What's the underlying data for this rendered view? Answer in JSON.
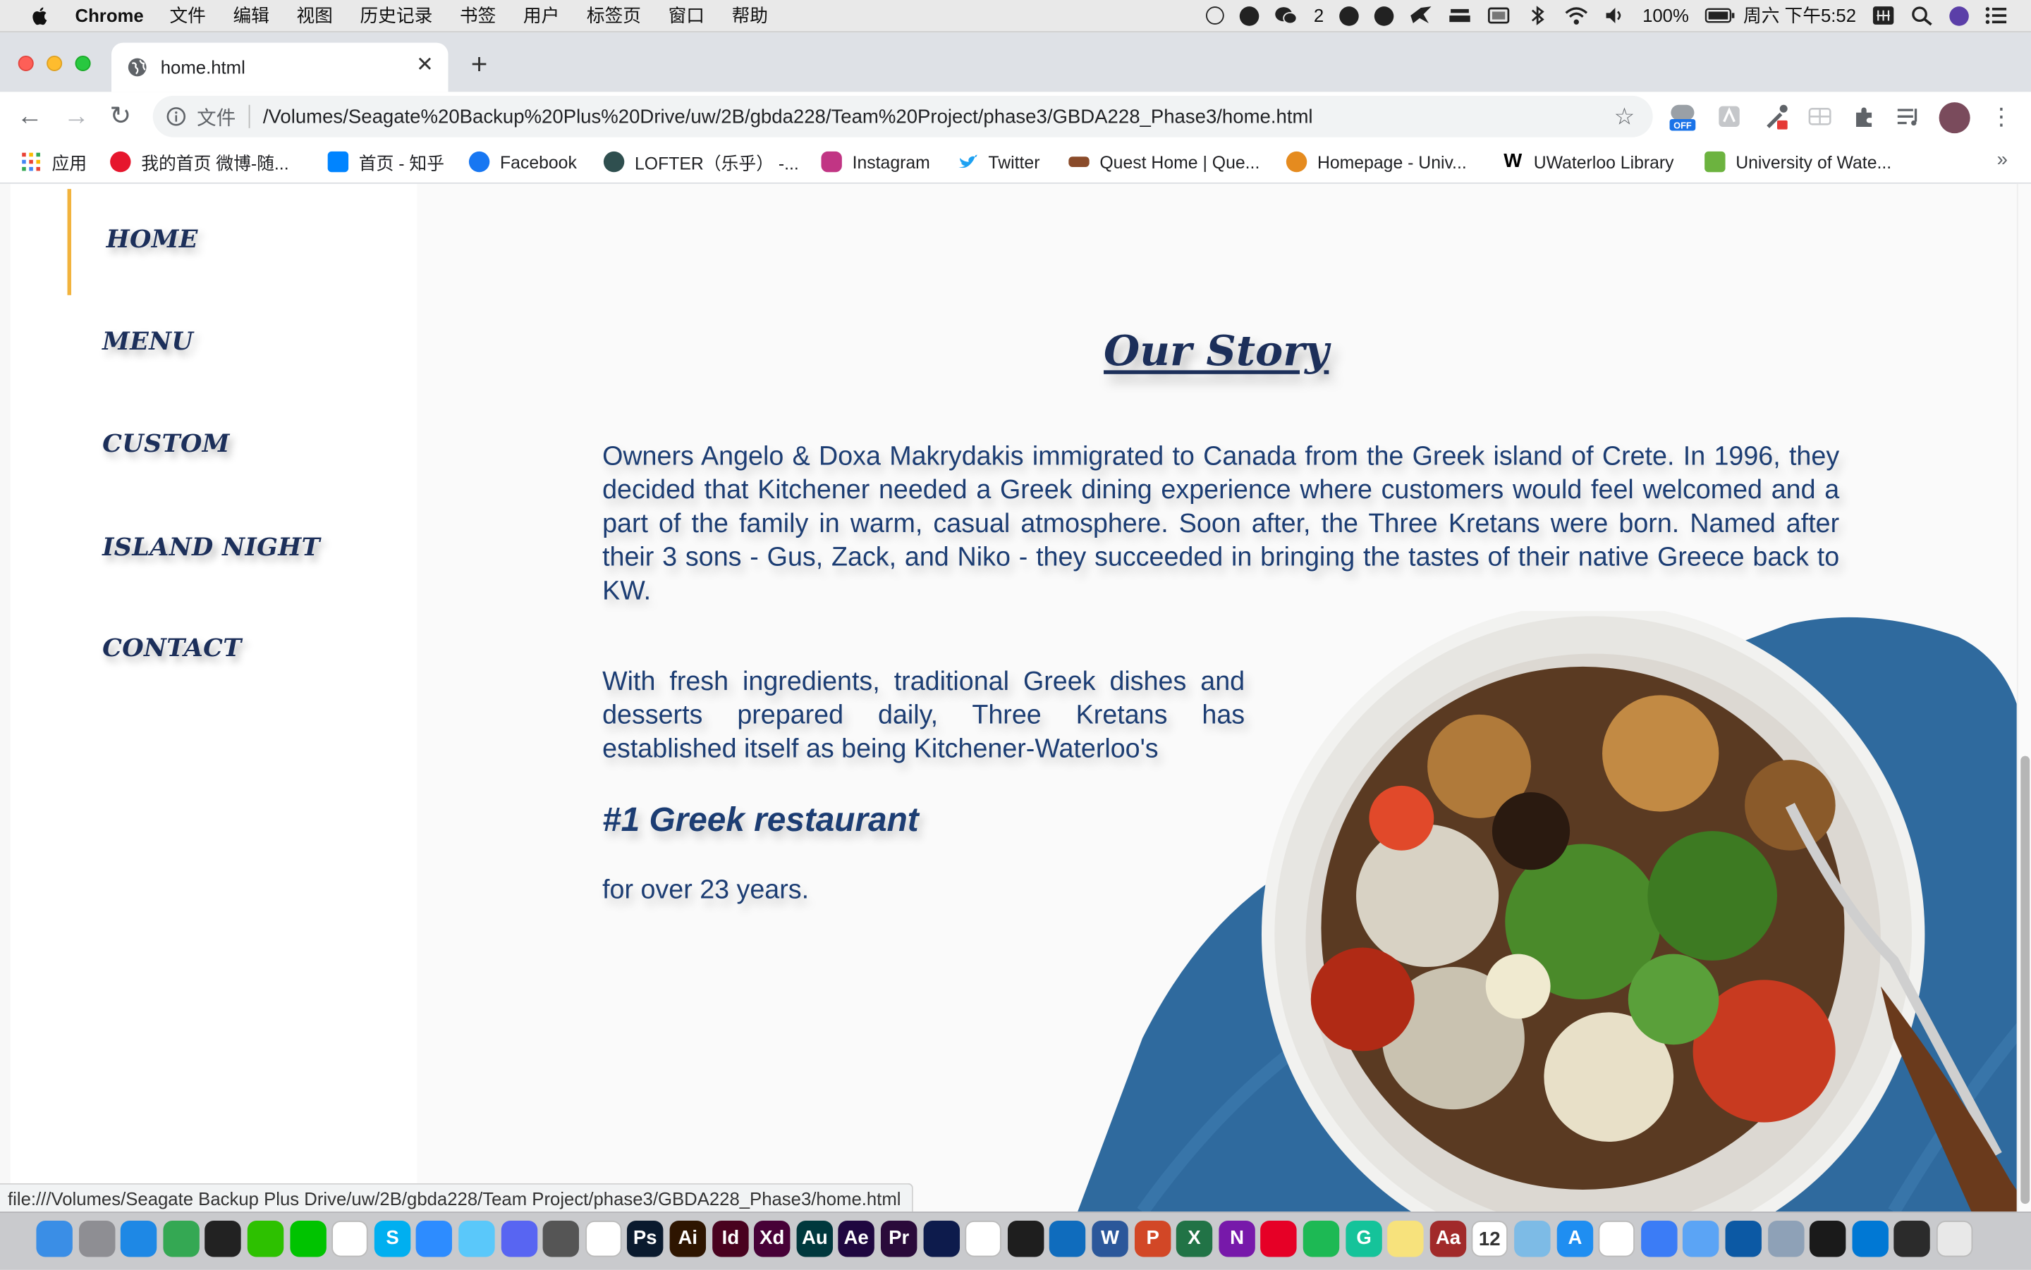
{
  "menubar": {
    "app_name": "Chrome",
    "menus": [
      "文件",
      "编辑",
      "视图",
      "历史记录",
      "书签",
      "用户",
      "标签页",
      "窗口",
      "帮助"
    ],
    "wechat_badge": "2",
    "battery": "100%",
    "datetime": "周六 下午5:52"
  },
  "tab": {
    "title": "home.html"
  },
  "toolbar": {
    "file_label": "文件",
    "url": "/Volumes/Seagate%20Backup%20Plus%20Drive/uw/2B/gbda228/Team%20Project/phase3/GBDA228_Phase3/home.html",
    "ext_badge": "OFF"
  },
  "bookmarks": [
    {
      "label": "应用",
      "icon": "apps-grid-icon",
      "color": "#e94235"
    },
    {
      "label": "我的首页 微博-随...",
      "icon": "weibo-icon",
      "color": "#e6162d"
    },
    {
      "label": "首页 - 知乎",
      "icon": "zhihu-icon",
      "color": "#0084ff"
    },
    {
      "label": "Facebook",
      "icon": "facebook-icon",
      "color": "#1877f2"
    },
    {
      "label": "LOFTER（乐乎） -...",
      "icon": "lofter-icon",
      "color": "#2f4f4f"
    },
    {
      "label": "Instagram",
      "icon": "instagram-icon",
      "color": "#c13584"
    },
    {
      "label": "Twitter",
      "icon": "twitter-icon",
      "color": "#1da1f2"
    },
    {
      "label": "Quest Home | Que...",
      "icon": "quest-icon",
      "color": "#8a4b2a"
    },
    {
      "label": "Homepage - Univ...",
      "icon": "uw-homepage-icon",
      "color": "#e58b1f"
    },
    {
      "label": "UWaterloo Library",
      "icon": "uwaterloo-library-icon",
      "color": "#000000"
    },
    {
      "label": "University of Wate...",
      "icon": "uw-flag-icon",
      "color": "#6cb33f"
    }
  ],
  "page": {
    "nav": [
      "HOME",
      "MENU",
      "CUSTOM",
      "ISLAND NIGHT",
      "CONTACT"
    ],
    "active_nav": "HOME",
    "title": "Our Story",
    "paragraph1": "Owners Angelo & Doxa Makrydakis immigrated to Canada from the Greek island of Crete. In 1996, they decided that Kitchener needed a Greek dining experience where customers would feel welcomed and a part of the family in warm, casual atmosphere. Soon after, the Three Kretans were born. Named after their 3 sons - Gus, Zack, and Niko - they succeeded in bringing the tastes of their native Greece back to KW.",
    "paragraph2": "With fresh ingredients, traditional Greek dishes and desserts prepared daily, Three Kretans has established itself as being Kitchener-Waterloo's",
    "highlight": "#1 Greek restaurant",
    "paragraph3": "for over 23 years.",
    "status_url": "file:///Volumes/Seagate Backup Plus Drive/uw/2B/gbda228/Team Project/phase3/GBDA228_Phase3/home.html"
  },
  "colors": {
    "nav_text": "#1c2f5a",
    "accent_bar": "#f2b33d",
    "body_text": "#1c3d73",
    "napkin": "#2f6a9e"
  },
  "dock": [
    {
      "name": "finder-icon",
      "color": "#3a8ee6",
      "label": ""
    },
    {
      "name": "launchpad-icon",
      "color": "#8e8e93",
      "label": ""
    },
    {
      "name": "safari-icon",
      "color": "#1e88e5",
      "label": ""
    },
    {
      "name": "chrome-icon",
      "color": "#34a853",
      "label": ""
    },
    {
      "name": "qq-icon",
      "color": "#222222",
      "label": ""
    },
    {
      "name": "wechat-icon",
      "color": "#2dc100",
      "label": ""
    },
    {
      "name": "line-icon",
      "color": "#00c300",
      "label": ""
    },
    {
      "name": "slack-icon",
      "color": "#ffffff",
      "label": ""
    },
    {
      "name": "skype-icon",
      "color": "#00aff0",
      "label": "S"
    },
    {
      "name": "zoom-icon",
      "color": "#2d8cff",
      "label": ""
    },
    {
      "name": "messages-icon",
      "color": "#5ac8fa",
      "label": ""
    },
    {
      "name": "discord-icon",
      "color": "#5865f2",
      "label": ""
    },
    {
      "name": "facetime-icon",
      "color": "#555555",
      "label": ""
    },
    {
      "name": "circle-app-icon",
      "color": "#ffffff",
      "label": ""
    },
    {
      "name": "photoshop-icon",
      "color": "#0a1a2e",
      "label": "Ps"
    },
    {
      "name": "illustrator-icon",
      "color": "#2e1500",
      "label": "Ai"
    },
    {
      "name": "indesign-icon",
      "color": "#49021f",
      "label": "Id"
    },
    {
      "name": "xd-icon",
      "color": "#470137",
      "label": "Xd"
    },
    {
      "name": "audition-icon",
      "color": "#00383d",
      "label": "Au"
    },
    {
      "name": "after-effects-icon",
      "color": "#1f0740",
      "label": "Ae"
    },
    {
      "name": "premiere-icon",
      "color": "#2a0a3a",
      "label": "Pr"
    },
    {
      "name": "media-encoder-icon",
      "color": "#0d1b4c",
      "label": ""
    },
    {
      "name": "emoji-app-icon",
      "color": "#ffffff",
      "label": ""
    },
    {
      "name": "figma-icon",
      "color": "#1e1e1e",
      "label": ""
    },
    {
      "name": "outlook-icon",
      "color": "#0f6cbd",
      "label": ""
    },
    {
      "name": "word-icon",
      "color": "#2b579a",
      "label": "W"
    },
    {
      "name": "powerpoint-icon",
      "color": "#d24726",
      "label": "P"
    },
    {
      "name": "excel-icon",
      "color": "#217346",
      "label": "X"
    },
    {
      "name": "onenote-icon",
      "color": "#7719aa",
      "label": "N"
    },
    {
      "name": "netease-music-icon",
      "color": "#e60026",
      "label": ""
    },
    {
      "name": "spotify-icon",
      "color": "#1db954",
      "label": ""
    },
    {
      "name": "grammarly-icon",
      "color": "#15c39a",
      "label": "G"
    },
    {
      "name": "stickies-icon",
      "color": "#f7e27c",
      "label": ""
    },
    {
      "name": "dictionary-icon",
      "color": "#a12a2a",
      "label": "Aa"
    },
    {
      "name": "calendar-icon",
      "color": "#ffffff",
      "label": "12"
    },
    {
      "name": "preview-icon",
      "color": "#7dbbe6",
      "label": ""
    },
    {
      "name": "app-store-icon",
      "color": "#1f8ef1",
      "label": "A"
    },
    {
      "name": "baidu-netdisk-icon",
      "color": "#ffffff",
      "label": ""
    },
    {
      "name": "lark-icon",
      "color": "#3b7cf6",
      "label": ""
    },
    {
      "name": "feishu-icon",
      "color": "#5ba4f5",
      "label": ""
    },
    {
      "name": "edge-icon",
      "color": "#0c59a4",
      "label": ""
    },
    {
      "name": "screen-capture-icon",
      "color": "#8ea1b7",
      "label": ""
    },
    {
      "name": "activity-monitor-icon",
      "color": "#1a1a1a",
      "label": ""
    },
    {
      "name": "vscode-icon",
      "color": "#0078d4",
      "label": ""
    },
    {
      "name": "terminal-icon",
      "color": "#2b2b2b",
      "label": ""
    },
    {
      "name": "trash-icon",
      "color": "#e8e8e8",
      "label": ""
    }
  ]
}
